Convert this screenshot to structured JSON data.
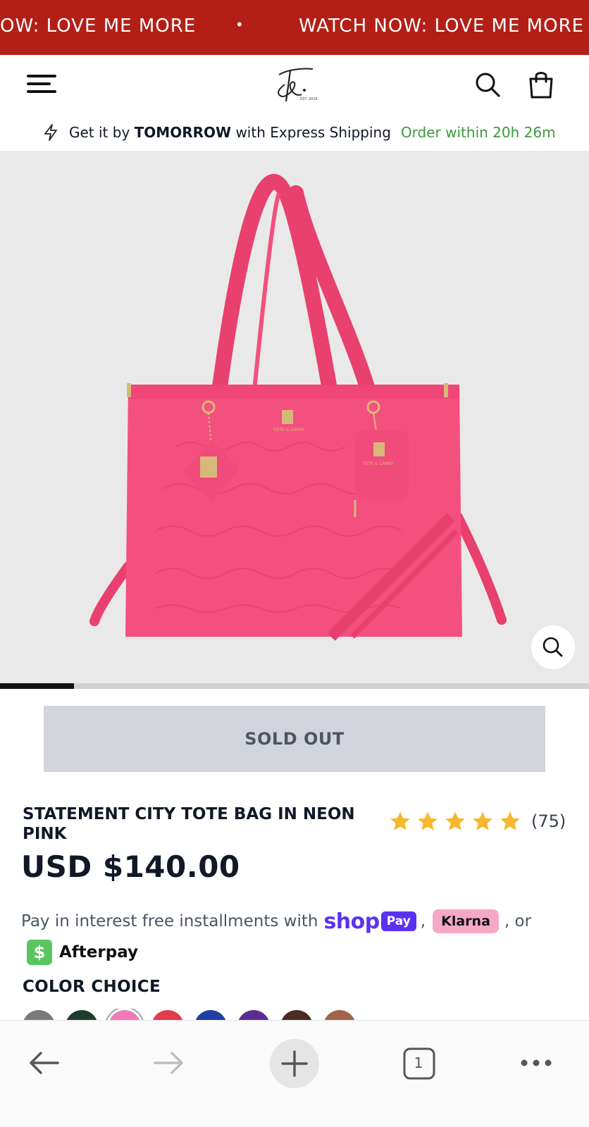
{
  "announcement": {
    "left_text": "OW: LOVE ME MORE",
    "separator": "•",
    "right_text": "WATCH NOW: LOVE ME MORE"
  },
  "header": {
    "menu_icon": "hamburger-menu-icon",
    "logo": "brand-monogram-logo",
    "search_icon": "search-icon",
    "cart_icon": "shopping-bag-icon"
  },
  "shipping": {
    "icon": "lightning-bolt-icon",
    "prefix": "Get it by",
    "highlight": "TOMORROW",
    "suffix": "with Express Shipping",
    "countdown": "Order within 20h 26m"
  },
  "gallery": {
    "image_alt": "Pink croc-embossed tote bag",
    "zoom_icon": "zoom-icon",
    "progress_fraction": 0.125
  },
  "product": {
    "sold_out_label": "SOLD OUT",
    "title": "STATEMENT CITY TOTE BAG IN NEON PINK",
    "rating": 5,
    "review_count": "(75)",
    "price": "USD $140.00"
  },
  "installments": {
    "text": "Pay in interest free installments with",
    "shop_word": "shop",
    "pay_badge": "Pay",
    "comma": ",",
    "klarna": "Klarna",
    "or": ", or",
    "afterpay_symbol": "$",
    "afterpay": "Afterpay"
  },
  "color_choice": {
    "heading": "COLOR CHOICE",
    "swatches": [
      {
        "color": "#7a7a7a"
      },
      {
        "color": "#1f3d2f"
      },
      {
        "color": "#f27ab8",
        "selected": true
      },
      {
        "color": "#e13a4c"
      },
      {
        "color": "#1f3fa3"
      },
      {
        "color": "#5c2d91"
      },
      {
        "color": "#4a2a22"
      },
      {
        "color": "#a0644a"
      }
    ]
  },
  "browser_toolbar": {
    "back_icon": "back-arrow-icon",
    "forward_icon": "forward-arrow-icon",
    "new_tab_icon": "plus-icon",
    "tab_count": "1",
    "more_icon": "more-dots-icon"
  },
  "colors": {
    "brand_red": "#b31f17",
    "bag_pink": "#f4507f",
    "green": "#3a9a3e",
    "shop_purple": "#5a31f4",
    "star": "#f5b82e"
  }
}
